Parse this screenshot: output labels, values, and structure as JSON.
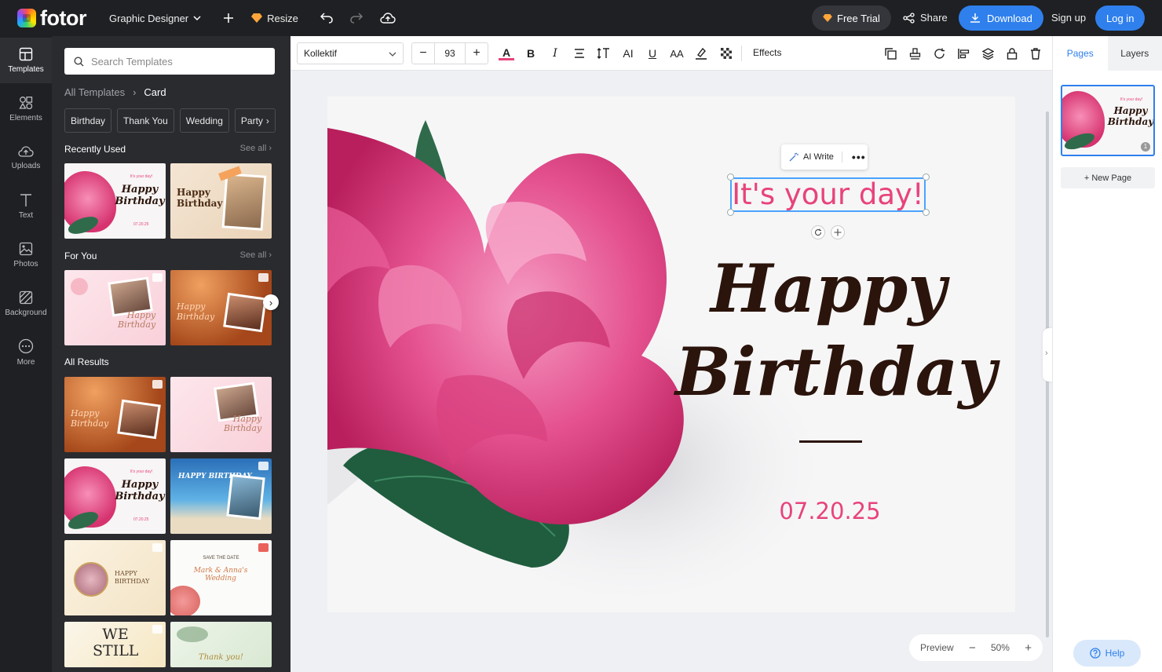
{
  "app": {
    "logo_text": "fotor",
    "brand_color": "#2f80ed"
  },
  "topbar": {
    "workspace_label": "Graphic Designer",
    "resize_label": "Resize",
    "free_trial_label": "Free Trial",
    "share_label": "Share",
    "download_label": "Download",
    "signup_label": "Sign up",
    "login_label": "Log in"
  },
  "nav": [
    {
      "label": "Templates",
      "icon": "template-icon"
    },
    {
      "label": "Elements",
      "icon": "elements-icon"
    },
    {
      "label": "Uploads",
      "icon": "upload-icon"
    },
    {
      "label": "Text",
      "icon": "text-icon"
    },
    {
      "label": "Photos",
      "icon": "photo-icon"
    },
    {
      "label": "Background",
      "icon": "background-icon"
    },
    {
      "label": "More",
      "icon": "more-icon"
    }
  ],
  "panel": {
    "search_placeholder": "Search Templates",
    "breadcrumb": {
      "root": "All Templates",
      "current": "Card"
    },
    "chips": [
      "Birthday",
      "Thank You",
      "Wedding",
      "Party"
    ],
    "recently_used": "Recently Used",
    "for_you": "For You",
    "all_results": "All Results",
    "see_all": "See all"
  },
  "thumbs_text": {
    "day": "It's your day!",
    "happy": "Happy",
    "birthday": "Birthday",
    "date": "07.20.25",
    "happy_birthday_caps": "HAPPY BIRTHDAY",
    "save_date": "SAVE THE DATE",
    "names": "Mark & Anna's Wedding",
    "we_still": "WE STILL",
    "thank": "Thank you!"
  },
  "toolbar": {
    "font": "Kollektif",
    "size": "93",
    "effects_label": "Effects",
    "text_color": "#e8437c"
  },
  "canvas": {
    "subtitle": "It's your day!",
    "title_line1": "Happy",
    "title_line2": "Birthday",
    "date": "07.20.25",
    "ai_write": "AI Write",
    "accent": "#e8437c",
    "title_color": "#2b140b"
  },
  "zoom": {
    "preview": "Preview",
    "level": "50%"
  },
  "right_panel": {
    "pages_tab": "Pages",
    "layers_tab": "Layers",
    "page_number": "1",
    "new_page": "+ New Page"
  },
  "help_label": "Help"
}
